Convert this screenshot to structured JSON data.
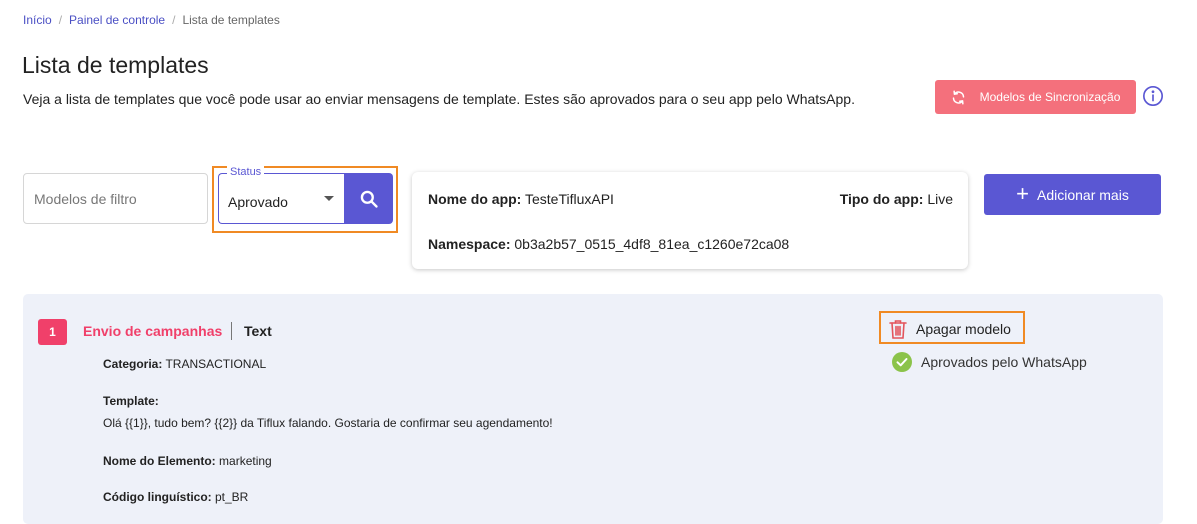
{
  "breadcrumb": {
    "items": [
      "Início",
      "Painel de controle"
    ],
    "separator": "/",
    "current": "Lista de templates"
  },
  "page": {
    "title": "Lista de templates",
    "subtitle": "Veja a lista de templates que você pode usar ao enviar mensagens de template. Estes são aprovados para o seu app pelo WhatsApp."
  },
  "actions": {
    "sync_label": "Modelos de Sincronização",
    "add_label": "Adicionar mais"
  },
  "filter": {
    "placeholder": "Modelos de filtro",
    "status_legend": "Status",
    "status_value": "Aprovado"
  },
  "app": {
    "name_label": "Nome do app:",
    "name_value": "TesteTifluxAPI",
    "type_label": "Tipo do app:",
    "type_value": "Live",
    "namespace_label": "Namespace:",
    "namespace_value": "0b3a2b57_0515_4df8_81ea_c1260e72ca08"
  },
  "template": {
    "index": "1",
    "name": "Envio de campanhas",
    "type": "Text",
    "category_label": "Categoria:",
    "category_value": "TRANSACTIONAL",
    "template_label": "Template:",
    "template_value": "Olá {{1}}, tudo bem? {{2}} da Tiflux falando. Gostaria de confirmar seu agendamento!",
    "element_label": "Nome do Elemento:",
    "element_value": "marketing",
    "language_label": "Código linguístico:",
    "language_value": "pt_BR",
    "delete_label": "Apagar modelo",
    "status_text": "Aprovados pelo WhatsApp"
  },
  "colors": {
    "primary": "#5a57d3",
    "accent_pink": "#f0406a",
    "sync_button": "#f4707c",
    "highlight": "#f08a24",
    "approved": "#8bc34a",
    "panel_bg": "#eef1f9"
  },
  "icons": {
    "sync": "sync-icon",
    "info": "info-icon",
    "search": "search-icon",
    "add": "plus-icon",
    "delete": "trash-icon",
    "approved": "check-circle-icon"
  }
}
